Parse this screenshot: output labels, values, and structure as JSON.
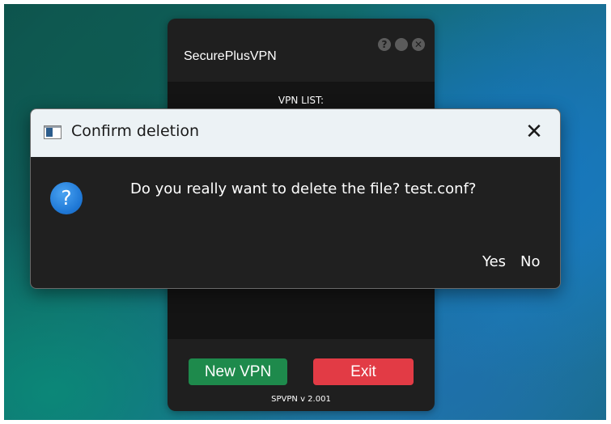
{
  "app": {
    "title": "SecurePlusVPN",
    "controls": {
      "help_glyph": "?",
      "minimize_glyph": "●",
      "close_glyph": "✕"
    },
    "list_header": "VPN LIST:",
    "new_vpn_label": "New VPN",
    "exit_label": "Exit",
    "version": "SPVPN v 2.001",
    "colors": {
      "new_vpn": "#1e8a4c",
      "exit": "#e23b45",
      "window_bg": "#1f1f1f"
    }
  },
  "dialog": {
    "title": "Confirm deletion",
    "close_glyph": "✕",
    "question_glyph": "?",
    "message": "Do you really want to delete the file? test.conf?",
    "yes_label": "Yes",
    "no_label": "No",
    "icons": {
      "app": "window-icon",
      "message": "question-icon"
    }
  }
}
